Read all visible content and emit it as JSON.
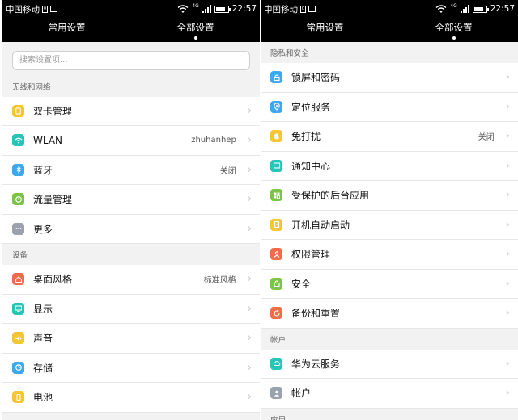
{
  "status": {
    "carrier": "中国移动",
    "sim_glyph": "0",
    "network": "4G",
    "time": "22:57"
  },
  "tabs": [
    {
      "label": "常用设置"
    },
    {
      "label": "全部设置"
    }
  ],
  "left": {
    "search_placeholder": "搜索设置项...",
    "sections": [
      {
        "header": "无线和网络",
        "items": [
          {
            "label": "双卡管理",
            "value": "",
            "icon": "sim-card-icon",
            "color": "#f7c531"
          },
          {
            "label": "WLAN",
            "value": "zhuhanhep",
            "icon": "wifi-icon",
            "color": "#27c4b8"
          },
          {
            "label": "蓝牙",
            "value": "关闭",
            "icon": "bluetooth-icon",
            "color": "#3ea8ec"
          },
          {
            "label": "流量管理",
            "value": "",
            "icon": "data-usage-icon",
            "color": "#7bc34a"
          },
          {
            "label": "更多",
            "value": "",
            "icon": "more-icon",
            "color": "#9aa3ad"
          }
        ]
      },
      {
        "header": "设备",
        "items": [
          {
            "label": "桌面风格",
            "value": "标准风格",
            "icon": "home-icon",
            "color": "#f26b4b"
          },
          {
            "label": "显示",
            "value": "",
            "icon": "display-icon",
            "color": "#27c4b8"
          },
          {
            "label": "声音",
            "value": "",
            "icon": "sound-icon",
            "color": "#f7c531"
          },
          {
            "label": "存储",
            "value": "",
            "icon": "storage-icon",
            "color": "#3ea8ec"
          },
          {
            "label": "电池",
            "value": "",
            "icon": "battery-icon",
            "color": "#f7c531"
          }
        ]
      }
    ]
  },
  "right": {
    "sections": [
      {
        "header": "隐私和安全",
        "items": [
          {
            "label": "锁屏和密码",
            "value": "",
            "icon": "lock-screen-icon",
            "color": "#3ea8ec"
          },
          {
            "label": "定位服务",
            "value": "",
            "icon": "location-icon",
            "color": "#3ea8ec"
          },
          {
            "label": "免打扰",
            "value": "关闭",
            "icon": "moon-icon",
            "color": "#f7c531"
          },
          {
            "label": "通知中心",
            "value": "",
            "icon": "notification-icon",
            "color": "#27c4b8"
          },
          {
            "label": "受保护的后台应用",
            "value": "",
            "icon": "protected-apps-icon",
            "color": "#7bc34a"
          },
          {
            "label": "开机自动启动",
            "value": "",
            "icon": "startup-icon",
            "color": "#f7c531"
          },
          {
            "label": "权限管理",
            "value": "",
            "icon": "permission-icon",
            "color": "#f26b4b"
          },
          {
            "label": "安全",
            "value": "",
            "icon": "security-icon",
            "color": "#7bc34a"
          },
          {
            "label": "备份和重置",
            "value": "",
            "icon": "backup-icon",
            "color": "#f26b4b"
          }
        ]
      },
      {
        "header": "帐户",
        "items": [
          {
            "label": "华为云服务",
            "value": "",
            "icon": "cloud-icon",
            "color": "#27c4b8"
          },
          {
            "label": "帐户",
            "value": "",
            "icon": "account-icon",
            "color": "#9aa3ad"
          }
        ]
      },
      {
        "header": "应用",
        "items": []
      }
    ]
  }
}
